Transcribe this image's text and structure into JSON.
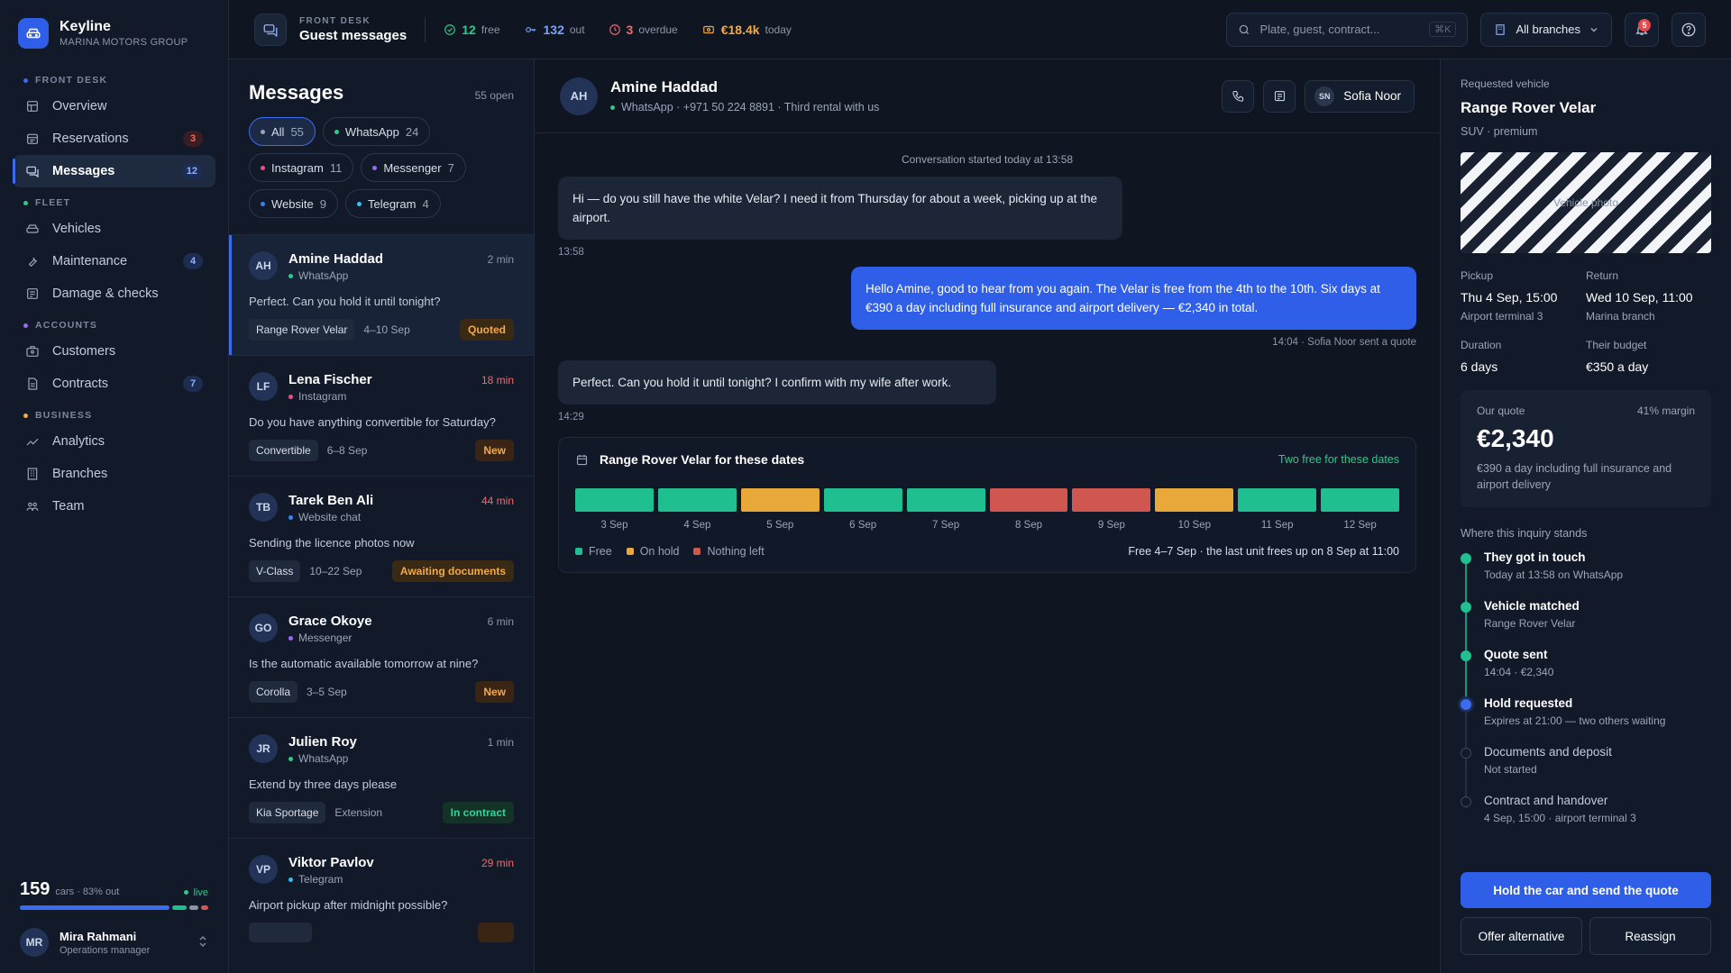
{
  "brand": {
    "name": "Keyline",
    "sub": "MARINA MOTORS GROUP"
  },
  "nav": {
    "sections": [
      {
        "label": "FRONT DESK",
        "color": "#3b6cf0"
      },
      {
        "label": "FLEET",
        "color": "#2fc98a"
      },
      {
        "label": "ACCOUNTS",
        "color": "#9b6cf0"
      },
      {
        "label": "BUSINESS",
        "color": "#f2a94a"
      }
    ],
    "items": [
      {
        "label": "Overview",
        "icon": "grid-icon"
      },
      {
        "label": "Reservations",
        "icon": "calendar-icon",
        "badge": "3"
      },
      {
        "label": "Messages",
        "icon": "chat-icon",
        "badge": "12"
      },
      {
        "label": "Vehicles",
        "icon": "car-icon"
      },
      {
        "label": "Maintenance",
        "icon": "wrench-icon",
        "badge": "4"
      },
      {
        "label": "Damage & checks",
        "icon": "clipboard-icon"
      },
      {
        "label": "Customers",
        "icon": "id-card-icon"
      },
      {
        "label": "Contracts",
        "icon": "document-icon",
        "badge": "7"
      },
      {
        "label": "Analytics",
        "icon": "trend-icon"
      },
      {
        "label": "Branches",
        "icon": "building-icon"
      },
      {
        "label": "Team",
        "icon": "people-icon"
      }
    ]
  },
  "fleet": {
    "count": "159",
    "text": "cars · 83% out",
    "live": "live"
  },
  "user": {
    "initials": "MR",
    "name": "Mira Rahmani",
    "role": "Operations manager"
  },
  "topbar": {
    "eyebrow": "FRONT DESK",
    "title": "Guest messages",
    "stats": [
      {
        "value": "12",
        "label": "free",
        "color": "#2fc98a"
      },
      {
        "value": "132",
        "label": "out",
        "color": "#7aa2ff"
      },
      {
        "value": "3",
        "label": "overdue",
        "color": "#f06a6a"
      },
      {
        "value": "€18.4k",
        "label": "today",
        "color": "#f2a94a"
      }
    ],
    "search_placeholder": "Plate, guest, contract...",
    "search_kbd": "⌘K",
    "branch": "All branches",
    "notifications": "5"
  },
  "messages": {
    "title": "Messages",
    "open": "55 open",
    "chips": [
      {
        "label": "All",
        "count": "55",
        "color": "#9aa5b8"
      },
      {
        "label": "WhatsApp",
        "count": "24",
        "color": "#2fc98a"
      },
      {
        "label": "Instagram",
        "count": "11",
        "color": "#e8508a"
      },
      {
        "label": "Messenger",
        "count": "7",
        "color": "#9b6cf0"
      },
      {
        "label": "Website",
        "count": "9",
        "color": "#3b82f6"
      },
      {
        "label": "Telegram",
        "count": "4",
        "color": "#38bdf8"
      }
    ],
    "conversations": [
      {
        "initials": "AH",
        "name": "Amine Haddad",
        "channel": "WhatsApp",
        "channel_color": "#2fc98a",
        "time": "2 min",
        "late": false,
        "message": "Perfect. Can you hold it until tonight?",
        "car": "Range Rover Velar",
        "dates": "4–10 Sep",
        "status": "Quoted",
        "status_class": "st-quoted"
      },
      {
        "initials": "LF",
        "name": "Lena Fischer",
        "channel": "Instagram",
        "channel_color": "#e8508a",
        "time": "18 min",
        "late": true,
        "message": "Do you have anything convertible for Saturday?",
        "car": "Convertible",
        "dates": "6–8 Sep",
        "status": "New",
        "status_class": "st-new"
      },
      {
        "initials": "TB",
        "name": "Tarek Ben Ali",
        "channel": "Website chat",
        "channel_color": "#3b82f6",
        "time": "44 min",
        "late": true,
        "message": "Sending the licence photos now",
        "car": "V-Class",
        "dates": "10–22 Sep",
        "status": "Awaiting documents",
        "status_class": "st-docs"
      },
      {
        "initials": "GO",
        "name": "Grace Okoye",
        "channel": "Messenger",
        "channel_color": "#9b6cf0",
        "time": "6 min",
        "late": false,
        "message": "Is the automatic available tomorrow at nine?",
        "car": "Corolla",
        "dates": "3–5 Sep",
        "status": "New",
        "status_class": "st-new"
      },
      {
        "initials": "JR",
        "name": "Julien Roy",
        "channel": "WhatsApp",
        "channel_color": "#2fc98a",
        "time": "1 min",
        "late": false,
        "message": "Extend by three days please",
        "car": "Kia Sportage",
        "dates": "Extension",
        "status": "In contract",
        "status_class": "st-contract"
      },
      {
        "initials": "VP",
        "name": "Viktor Pavlov",
        "channel": "Telegram",
        "channel_color": "#38bdf8",
        "time": "29 min",
        "late": true,
        "message": "Airport pickup after midnight possible?",
        "car": "",
        "dates": "",
        "status": "",
        "status_class": ""
      }
    ]
  },
  "chat": {
    "initials": "AH",
    "name": "Amine Haddad",
    "meta": "WhatsApp · +971 50 224 8891 · Third rental with us",
    "assignee_initials": "SN",
    "assignee": "Sofia Noor",
    "started": "Conversation started today at 13:58",
    "msg1": "Hi — do you still have the white Velar? I need it from Thursday for about a week, picking up at the airport.",
    "msg1_time": "13:58",
    "msg2": "Hello Amine, good to hear from you again. The Velar is free from the 4th to the 10th. Six days at €390 a day including full insurance and airport delivery — €2,340 in total.",
    "msg2_time": "14:04 · Sofia Noor sent a quote",
    "msg3": "Perfect. Can you hold it until tonight? I confirm with my wife after work.",
    "msg3_time": "14:29",
    "availability": {
      "title": "Range Rover Velar for these dates",
      "free_note": "Two free for these dates",
      "days": [
        {
          "label": "3 Sep",
          "state": "free"
        },
        {
          "label": "4 Sep",
          "state": "free"
        },
        {
          "label": "5 Sep",
          "state": "hold"
        },
        {
          "label": "6 Sep",
          "state": "free"
        },
        {
          "label": "7 Sep",
          "state": "free"
        },
        {
          "label": "8 Sep",
          "state": "none"
        },
        {
          "label": "9 Sep",
          "state": "none"
        },
        {
          "label": "10 Sep",
          "state": "hold"
        },
        {
          "label": "11 Sep",
          "state": "free"
        },
        {
          "label": "12 Sep",
          "state": "free"
        }
      ],
      "colors": {
        "free": "#1fbf8f",
        "hold": "#e8a93a",
        "none": "#d0574f"
      },
      "legend": [
        "Free",
        "On hold",
        "Nothing left"
      ],
      "note": "Free 4–7 Sep · the last unit frees up on 8 Sep at 11:00"
    }
  },
  "panel": {
    "label": "Requested vehicle",
    "car": "Range Rover Velar",
    "class": "SUV · premium",
    "photo": "Vehicle photo",
    "pickup_label": "Pickup",
    "pickup": "Thu 4 Sep, 15:00",
    "pickup_sub": "Airport terminal 3",
    "return_label": "Return",
    "return": "Wed 10 Sep, 11:00",
    "return_sub": "Marina branch",
    "duration_label": "Duration",
    "duration": "6 days",
    "budget_label": "Their budget",
    "budget": "€350 a day",
    "quote_label": "Our quote",
    "margin": "41% margin",
    "price": "€2,340",
    "price_desc": "€390 a day including full insurance and airport delivery",
    "stands": "Where this inquiry stands",
    "timeline": [
      {
        "title": "They got in touch",
        "sub": "Today at 13:58 on WhatsApp",
        "state": "done"
      },
      {
        "title": "Vehicle matched",
        "sub": "Range Rover Velar",
        "state": "done"
      },
      {
        "title": "Quote sent",
        "sub": "14:04 · €2,340",
        "state": "done"
      },
      {
        "title": "Hold requested",
        "sub": "Expires at 21:00 — two others waiting",
        "state": "current"
      },
      {
        "title": "Documents and deposit",
        "sub": "Not started",
        "state": "todo"
      },
      {
        "title": "Contract and handover",
        "sub": "4 Sep, 15:00 · airport terminal 3",
        "state": "todo"
      }
    ],
    "primary": "Hold the car and send the quote",
    "alt": "Offer alternative",
    "reassign": "Reassign"
  }
}
